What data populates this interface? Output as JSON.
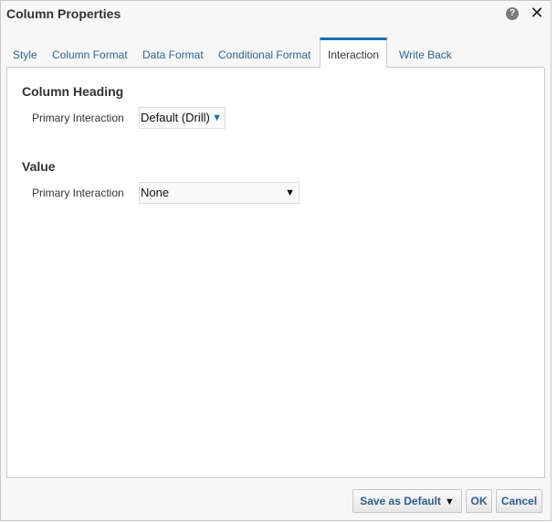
{
  "dialog": {
    "title": "Column Properties",
    "help_icon": "help-icon",
    "close_icon": "close-icon"
  },
  "tabs": [
    {
      "label": "Style",
      "active": false
    },
    {
      "label": "Column Format",
      "active": false
    },
    {
      "label": "Data Format",
      "active": false
    },
    {
      "label": "Conditional Format",
      "active": false
    },
    {
      "label": "Interaction",
      "active": true
    },
    {
      "label": "Write Back",
      "active": false
    }
  ],
  "column_heading": {
    "title": "Column Heading",
    "primary_interaction_label": "Primary Interaction",
    "primary_interaction_value": "Default (Drill)"
  },
  "value": {
    "title": "Value",
    "primary_interaction_label": "Primary Interaction",
    "primary_interaction_value": "None"
  },
  "footer": {
    "save_as_default": "Save as Default",
    "ok": "OK",
    "cancel": "Cancel"
  },
  "colors": {
    "accent": "#1d6fb0",
    "link": "#2f6695",
    "border": "#c8c8c8"
  }
}
